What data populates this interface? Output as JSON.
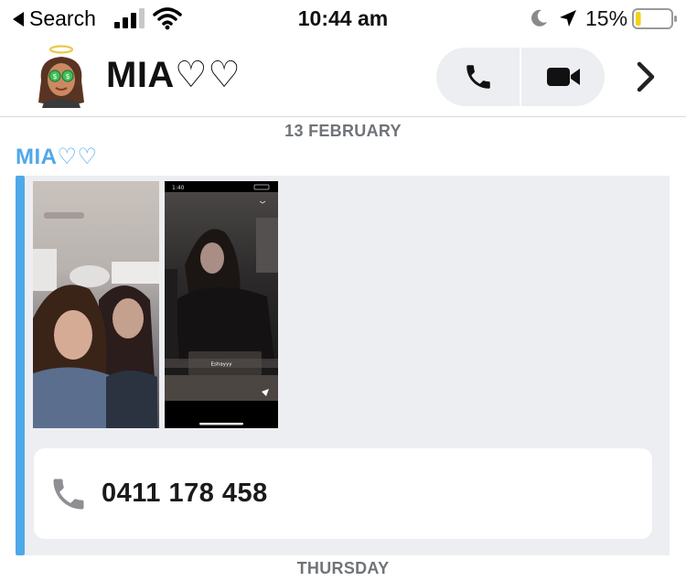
{
  "status_bar": {
    "back_label": "Search",
    "time": "10:44 am",
    "battery_percent": "15%",
    "battery_level": 0.15,
    "battery_color": "#f2d21b"
  },
  "header": {
    "chat_name": "MIA♡♡",
    "call_icon": "phone-icon",
    "video_icon": "video-camera-icon",
    "more_icon": "chevron-right-icon"
  },
  "chat": {
    "date_divider": "13 FEBRUARY",
    "sender": "MIA♡♡",
    "accent_color": "#4fa8e8",
    "photo2_inner": {
      "time": "1:40",
      "caption": "Eshayyy"
    },
    "contact_card": {
      "icon": "phone-icon",
      "number": "0411 178 458"
    },
    "next_divider": "THURSDAY"
  }
}
